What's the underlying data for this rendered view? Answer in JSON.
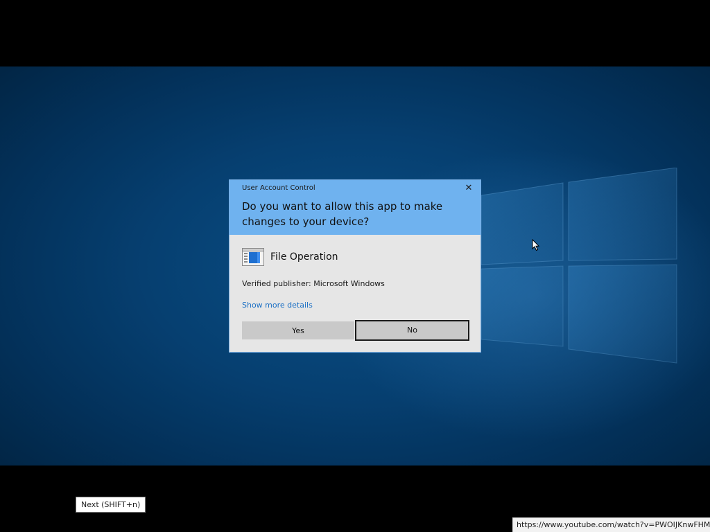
{
  "uac_dialog": {
    "caption": "User Account Control",
    "question": "Do you want to allow this app to make changes to your device?",
    "app_name": "File Operation",
    "publisher": "Verified publisher: Microsoft Windows",
    "details_link": "Show more details",
    "yes_label": "Yes",
    "no_label": "No",
    "close_icon": "close-icon",
    "app_icon": "file-operation-icon",
    "header_color": "#6fb2ef"
  },
  "tooltip": {
    "text": "Next (SHIFT+n)"
  },
  "status_url": {
    "text": "https://www.youtube.com/watch?v=PWOIJKnwFHM"
  },
  "desktop": {
    "background_color": "#063f70",
    "logo": "windows-logo"
  }
}
